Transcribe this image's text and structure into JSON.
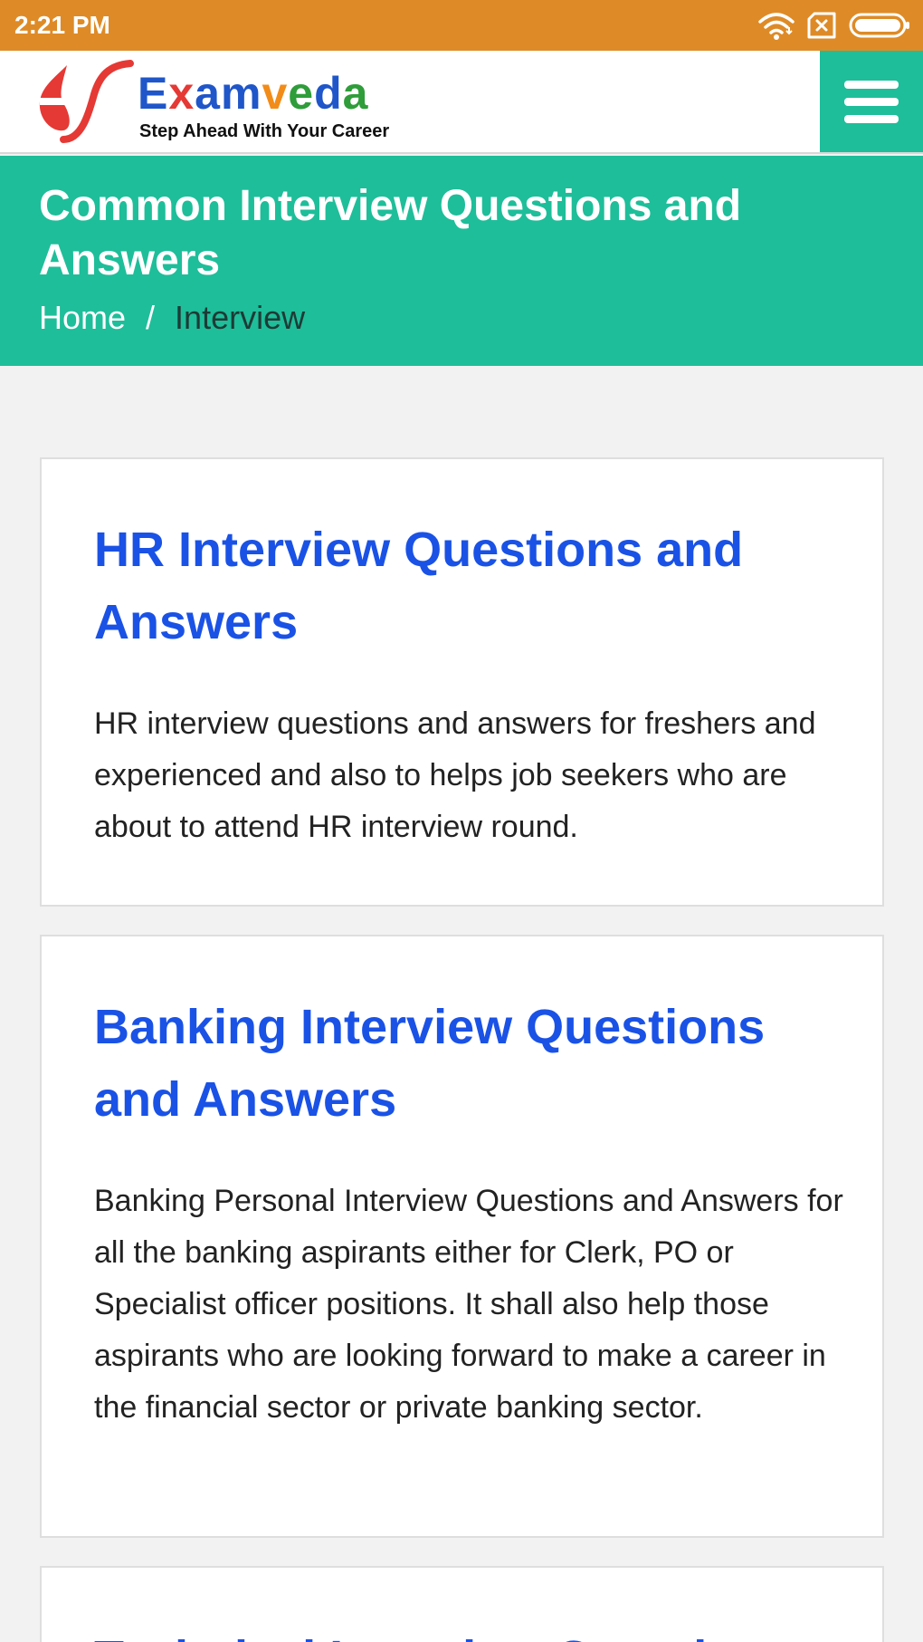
{
  "status_bar": {
    "time": "2:21 PM"
  },
  "header": {
    "logo": {
      "name_letters": [
        {
          "char": "E",
          "color": "blue"
        },
        {
          "char": "x",
          "color": "red"
        },
        {
          "char": "a",
          "color": "blue"
        },
        {
          "char": "m",
          "color": "blue"
        },
        {
          "char": "v",
          "color": "orange"
        },
        {
          "char": "e",
          "color": "green"
        },
        {
          "char": "d",
          "color": "blue"
        },
        {
          "char": "a",
          "color": "green"
        }
      ],
      "name": "Examveda",
      "tagline": "Step Ahead With Your Career"
    }
  },
  "banner": {
    "title": "Common Interview Questions and Answers",
    "breadcrumb": {
      "home": "Home",
      "separator": "/",
      "current": "Interview"
    }
  },
  "cards": [
    {
      "title": "HR Interview Questions and Answers",
      "description": "HR interview questions and answers for freshers and experienced and also to helps job seekers who are about to attend HR interview round."
    },
    {
      "title": "Banking Interview Questions and Answers",
      "description": "Banking Personal Interview Questions and Answers for all the banking aspirants either for Clerk, PO or Specialist officer positions. It shall also help those aspirants who are looking forward to make a career in the financial sector or private banking sector."
    },
    {
      "title": "Technical Interview Questions",
      "description": ""
    }
  ],
  "icons": {
    "status": [
      "wifi-icon",
      "no-sim-icon",
      "battery-icon"
    ],
    "menu": "hamburger-menu-icon",
    "logo": "logo-swoosh-icon"
  },
  "colors": {
    "status_bar": "#de8b27",
    "accent": "#1ebe9a",
    "link": "#1a52e6",
    "background": "#f2f2f2"
  }
}
